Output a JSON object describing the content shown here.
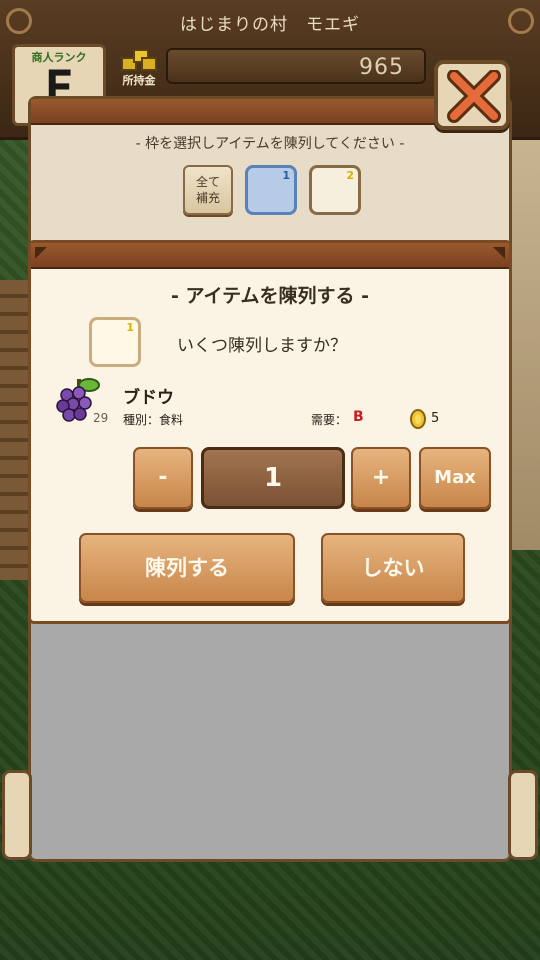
{
  "header": {
    "village_title": "はじまりの村　モエギ",
    "rank_label": "商人ランク",
    "rank_value": "F",
    "gold_label": "所持金",
    "gold_value": "965"
  },
  "slots": {
    "instruction": "- 枠を選択しアイテムを陳列してください -",
    "fill_all_label_line1": "全て",
    "fill_all_label_line2": "補充",
    "items": [
      {
        "number": "1",
        "selected": true
      },
      {
        "number": "2",
        "selected": false
      }
    ]
  },
  "dialog": {
    "title": "- アイテムを陳列する -",
    "target_slot_number": "1",
    "question": "いくつ陳列しますか？",
    "item": {
      "name": "ブドウ",
      "stock": "29",
      "category": "種別：食料",
      "demand_label": "需要：",
      "demand_value": "B",
      "price": "5"
    },
    "quantity": "1",
    "minus_label": "-",
    "plus_label": "+",
    "max_label": "Max",
    "display_label": "陳列する",
    "cancel_label": "しない"
  },
  "colors": {
    "accent_button": "#c8864a",
    "selected_slot": "#b6cbe6",
    "demand_color": "#c81e1e",
    "slot_number_color": "#d4b400"
  },
  "icons": [
    "gold-pile-icon",
    "close-icon",
    "grape-icon",
    "coin-icon"
  ]
}
